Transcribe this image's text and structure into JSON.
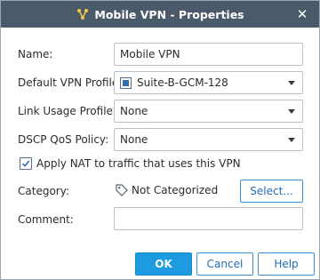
{
  "window": {
    "title": "Mobile VPN - Properties",
    "close_glyph": "✕"
  },
  "form": {
    "name_label": "Name:",
    "name_value": "Mobile VPN",
    "vpn_profile_label": "Default VPN Profile:",
    "vpn_profile_value": "Suite-B-GCM-128",
    "link_usage_label": "Link Usage Profile:",
    "link_usage_value": "None",
    "dscp_label": "DSCP QoS Policy:",
    "dscp_value": "None",
    "nat_checkbox_label": "Apply NAT to traffic that uses this VPN",
    "nat_checked": true,
    "category_label": "Category:",
    "category_value": "Not Categorized",
    "select_button": "Select...",
    "comment_label": "Comment:",
    "comment_value": ""
  },
  "buttons": {
    "ok": "OK",
    "cancel": "Cancel",
    "help": "Help"
  },
  "colors": {
    "titlebar": "#4b5a6b",
    "primary": "#1e9be0",
    "accent_border": "#3a8fd6"
  },
  "icons": {
    "title": "vpn-icon",
    "profile": "vpn-profile-icon",
    "category": "tag-icon",
    "close": "close-icon",
    "dropdown": "chevron-down-icon"
  }
}
